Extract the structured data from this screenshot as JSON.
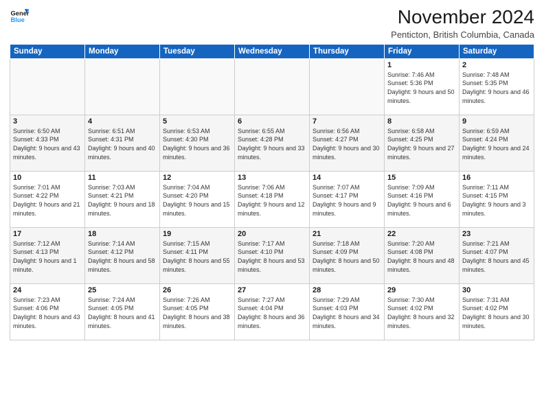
{
  "header": {
    "logo_line1": "General",
    "logo_line2": "Blue",
    "month": "November 2024",
    "location": "Penticton, British Columbia, Canada"
  },
  "days_of_week": [
    "Sunday",
    "Monday",
    "Tuesday",
    "Wednesday",
    "Thursday",
    "Friday",
    "Saturday"
  ],
  "weeks": [
    [
      {
        "day": "",
        "info": ""
      },
      {
        "day": "",
        "info": ""
      },
      {
        "day": "",
        "info": ""
      },
      {
        "day": "",
        "info": ""
      },
      {
        "day": "",
        "info": ""
      },
      {
        "day": "1",
        "info": "Sunrise: 7:46 AM\nSunset: 5:36 PM\nDaylight: 9 hours and 50 minutes."
      },
      {
        "day": "2",
        "info": "Sunrise: 7:48 AM\nSunset: 5:35 PM\nDaylight: 9 hours and 46 minutes."
      }
    ],
    [
      {
        "day": "3",
        "info": "Sunrise: 6:50 AM\nSunset: 4:33 PM\nDaylight: 9 hours and 43 minutes."
      },
      {
        "day": "4",
        "info": "Sunrise: 6:51 AM\nSunset: 4:31 PM\nDaylight: 9 hours and 40 minutes."
      },
      {
        "day": "5",
        "info": "Sunrise: 6:53 AM\nSunset: 4:30 PM\nDaylight: 9 hours and 36 minutes."
      },
      {
        "day": "6",
        "info": "Sunrise: 6:55 AM\nSunset: 4:28 PM\nDaylight: 9 hours and 33 minutes."
      },
      {
        "day": "7",
        "info": "Sunrise: 6:56 AM\nSunset: 4:27 PM\nDaylight: 9 hours and 30 minutes."
      },
      {
        "day": "8",
        "info": "Sunrise: 6:58 AM\nSunset: 4:25 PM\nDaylight: 9 hours and 27 minutes."
      },
      {
        "day": "9",
        "info": "Sunrise: 6:59 AM\nSunset: 4:24 PM\nDaylight: 9 hours and 24 minutes."
      }
    ],
    [
      {
        "day": "10",
        "info": "Sunrise: 7:01 AM\nSunset: 4:22 PM\nDaylight: 9 hours and 21 minutes."
      },
      {
        "day": "11",
        "info": "Sunrise: 7:03 AM\nSunset: 4:21 PM\nDaylight: 9 hours and 18 minutes."
      },
      {
        "day": "12",
        "info": "Sunrise: 7:04 AM\nSunset: 4:20 PM\nDaylight: 9 hours and 15 minutes."
      },
      {
        "day": "13",
        "info": "Sunrise: 7:06 AM\nSunset: 4:18 PM\nDaylight: 9 hours and 12 minutes."
      },
      {
        "day": "14",
        "info": "Sunrise: 7:07 AM\nSunset: 4:17 PM\nDaylight: 9 hours and 9 minutes."
      },
      {
        "day": "15",
        "info": "Sunrise: 7:09 AM\nSunset: 4:16 PM\nDaylight: 9 hours and 6 minutes."
      },
      {
        "day": "16",
        "info": "Sunrise: 7:11 AM\nSunset: 4:15 PM\nDaylight: 9 hours and 3 minutes."
      }
    ],
    [
      {
        "day": "17",
        "info": "Sunrise: 7:12 AM\nSunset: 4:13 PM\nDaylight: 9 hours and 1 minute."
      },
      {
        "day": "18",
        "info": "Sunrise: 7:14 AM\nSunset: 4:12 PM\nDaylight: 8 hours and 58 minutes."
      },
      {
        "day": "19",
        "info": "Sunrise: 7:15 AM\nSunset: 4:11 PM\nDaylight: 8 hours and 55 minutes."
      },
      {
        "day": "20",
        "info": "Sunrise: 7:17 AM\nSunset: 4:10 PM\nDaylight: 8 hours and 53 minutes."
      },
      {
        "day": "21",
        "info": "Sunrise: 7:18 AM\nSunset: 4:09 PM\nDaylight: 8 hours and 50 minutes."
      },
      {
        "day": "22",
        "info": "Sunrise: 7:20 AM\nSunset: 4:08 PM\nDaylight: 8 hours and 48 minutes."
      },
      {
        "day": "23",
        "info": "Sunrise: 7:21 AM\nSunset: 4:07 PM\nDaylight: 8 hours and 45 minutes."
      }
    ],
    [
      {
        "day": "24",
        "info": "Sunrise: 7:23 AM\nSunset: 4:06 PM\nDaylight: 8 hours and 43 minutes."
      },
      {
        "day": "25",
        "info": "Sunrise: 7:24 AM\nSunset: 4:05 PM\nDaylight: 8 hours and 41 minutes."
      },
      {
        "day": "26",
        "info": "Sunrise: 7:26 AM\nSunset: 4:05 PM\nDaylight: 8 hours and 38 minutes."
      },
      {
        "day": "27",
        "info": "Sunrise: 7:27 AM\nSunset: 4:04 PM\nDaylight: 8 hours and 36 minutes."
      },
      {
        "day": "28",
        "info": "Sunrise: 7:29 AM\nSunset: 4:03 PM\nDaylight: 8 hours and 34 minutes."
      },
      {
        "day": "29",
        "info": "Sunrise: 7:30 AM\nSunset: 4:02 PM\nDaylight: 8 hours and 32 minutes."
      },
      {
        "day": "30",
        "info": "Sunrise: 7:31 AM\nSunset: 4:02 PM\nDaylight: 8 hours and 30 minutes."
      }
    ]
  ]
}
